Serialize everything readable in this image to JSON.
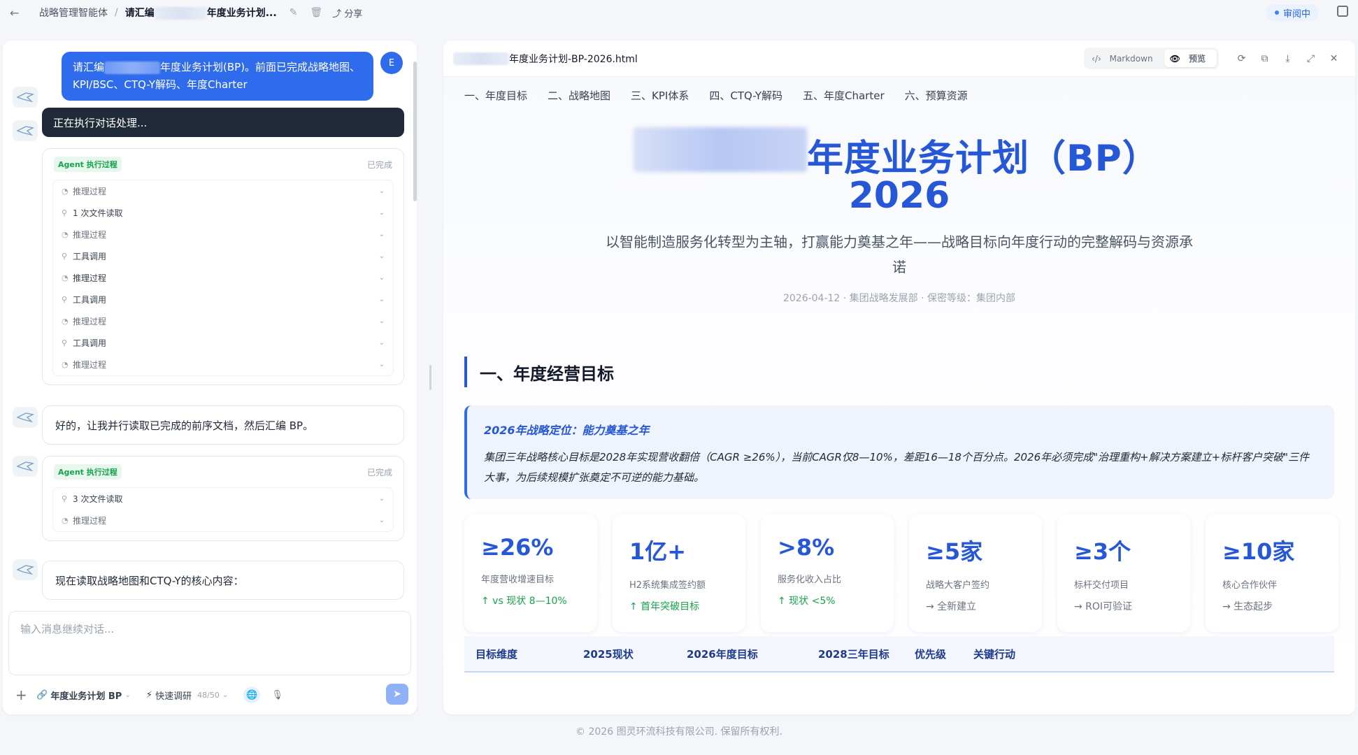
{
  "topbar": {
    "breadcrumb_root": "战略管理智能体",
    "breadcrumb_prefix": "请汇编",
    "breadcrumb_suffix": "年度业务计划...",
    "share": "分享",
    "status": "审阅中"
  },
  "chat": {
    "user_avatar": "E",
    "user_message_prefix": "请汇编",
    "user_message_suffix": "年度业务计划(BP)。前面已完成战略地图、KPI/BSC、CTQ-Y解码、年度Charter",
    "running": "正在执行对话处理...",
    "agent_tag": "Agent 执行过程",
    "agent_done": "已完成",
    "steps1": [
      {
        "icon": "reasoning-icon",
        "label": "推理过程"
      },
      {
        "icon": "tool-icon",
        "label": "1 次文件读取"
      },
      {
        "icon": "reasoning-icon",
        "label": "推理过程"
      },
      {
        "icon": "tool-icon",
        "label": "工具调用"
      },
      {
        "icon": "reasoning-icon",
        "label": "推理过程"
      },
      {
        "icon": "tool-icon",
        "label": "工具调用"
      },
      {
        "icon": "reasoning-icon",
        "label": "推理过程"
      },
      {
        "icon": "tool-icon",
        "label": "工具调用"
      },
      {
        "icon": "reasoning-icon",
        "label": "推理过程"
      }
    ],
    "reply1": "好的，让我并行读取已完成的前序文档，然后汇编 BP。",
    "steps2": [
      {
        "icon": "tool-icon",
        "label": "3 次文件读取"
      },
      {
        "icon": "reasoning-icon",
        "label": "推理过程"
      }
    ],
    "reply2": "现在读取战略地图和CTQ-Y的核心内容：",
    "input_placeholder": "输入消息继续对话...",
    "skill": "年度业务计划 BP",
    "mode": "快速调研",
    "mode_count": "48/50"
  },
  "preview": {
    "file_suffix": "年度业务计划-BP-2026.html",
    "view_markdown": "Markdown",
    "view_preview": "预览",
    "tabs": [
      "一、年度目标",
      "二、战略地图",
      "三、KPI体系",
      "四、CTQ-Y解码",
      "五、年度Charter",
      "六、预算资源"
    ],
    "hero_title": "年度业务计划（BP）",
    "hero_year": "2026",
    "hero_subtitle": "以智能制造服务化转型为主轴，打赢能力奠基之年——战略目标向年度行动的完整解码与资源承诺",
    "hero_meta": "2026-04-12 · 集团战略发展部 · 保密等级：集团内部",
    "section_title": "一、年度经营目标",
    "callout_title": "2026年战略定位：能力奠基之年",
    "callout_body": "集团三年战略核心目标是2028年实现营收翻倍（CAGR ≥26%），当前CAGR仅8—10%，差距16—18个百分点。2026年必须完成\"治理重构+解决方案建立+标杆客户突破\"三件大事，为后续规模扩张奠定不可逆的能力基础。",
    "kpis": [
      {
        "value": "≥26%",
        "label": "年度营收增速目标",
        "delta": "↑ vs 现状 8—10%",
        "trend": "up"
      },
      {
        "value": "1亿+",
        "label": "H2系统集成签约额",
        "delta": "↑ 首年突破目标",
        "trend": "up"
      },
      {
        "value": ">8%",
        "label": "服务化收入占比",
        "delta": "↑ 现状 <5%",
        "trend": "up"
      },
      {
        "value": "≥5家",
        "label": "战略大客户签约",
        "delta": "→ 全新建立",
        "trend": "flat"
      },
      {
        "value": "≥3个",
        "label": "标杆交付项目",
        "delta": "→ ROI可验证",
        "trend": "flat"
      },
      {
        "value": "≥10家",
        "label": "核心合作伙伴",
        "delta": "→ 生态起步",
        "trend": "flat"
      }
    ],
    "table_headers": [
      "目标维度",
      "2025现状",
      "2026年度目标",
      "2028三年目标",
      "优先级",
      "关键行动"
    ]
  },
  "footer": "© 2026 图灵环流科技有限公司. 保留所有权利."
}
